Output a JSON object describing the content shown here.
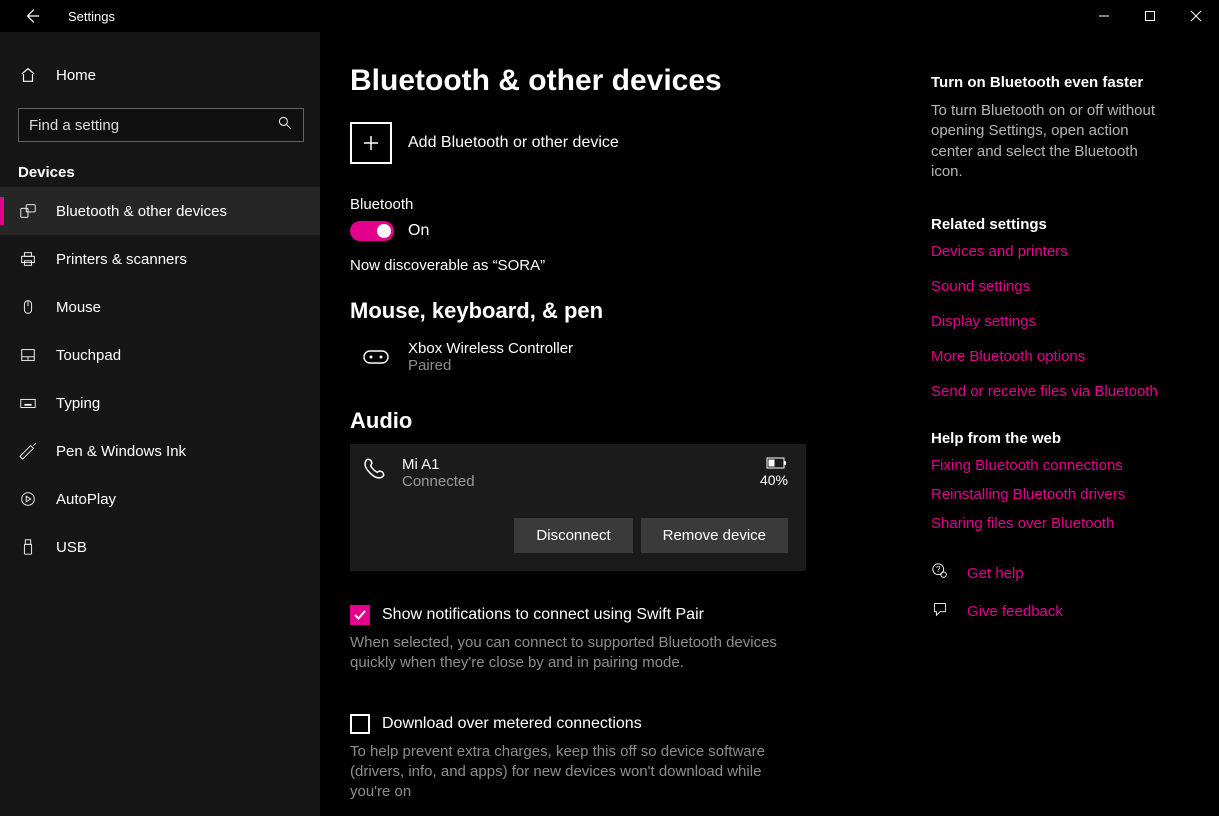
{
  "window": {
    "app_title": "Settings",
    "min": "—",
    "max": "▢",
    "close": "✕"
  },
  "sidebar": {
    "home": "Home",
    "search_placeholder": "Find a setting",
    "group": "Devices",
    "items": [
      "Bluetooth & other devices",
      "Printers & scanners",
      "Mouse",
      "Touchpad",
      "Typing",
      "Pen & Windows Ink",
      "AutoPlay",
      "USB"
    ]
  },
  "main": {
    "title": "Bluetooth & other devices",
    "add_label": "Add Bluetooth or other device",
    "bt_label": "Bluetooth",
    "bt_state": "On",
    "discoverable": "Now discoverable as “SORA”",
    "sect_mouse": "Mouse, keyboard, & pen",
    "dev1_name": "Xbox Wireless Controller",
    "dev1_status": "Paired",
    "sect_audio": "Audio",
    "dev2_name": "Mi A1",
    "dev2_status": "Connected",
    "dev2_battery": "40%",
    "btn_disconnect": "Disconnect",
    "btn_remove": "Remove device",
    "swift_label": "Show notifications to connect using Swift Pair",
    "swift_desc": "When selected, you can connect to supported Bluetooth devices quickly when they're close by and in pairing mode.",
    "metered_label": "Download over metered connections",
    "metered_desc": "To help prevent extra charges, keep this off so device software (drivers, info, and apps) for new devices won't download while you're on"
  },
  "aside": {
    "tip_h": "Turn on Bluetooth even faster",
    "tip_p": "To turn Bluetooth on or off without opening Settings, open action center and select the Bluetooth icon.",
    "related_h": "Related settings",
    "related": [
      "Devices and printers",
      "Sound settings",
      "Display settings",
      "More Bluetooth options",
      "Send or receive files via Bluetooth"
    ],
    "help_h": "Help from the web",
    "help": [
      "Fixing Bluetooth connections",
      "Reinstalling Bluetooth drivers",
      "Sharing files over Bluetooth"
    ],
    "get_help": "Get help",
    "give_feedback": "Give feedback"
  }
}
